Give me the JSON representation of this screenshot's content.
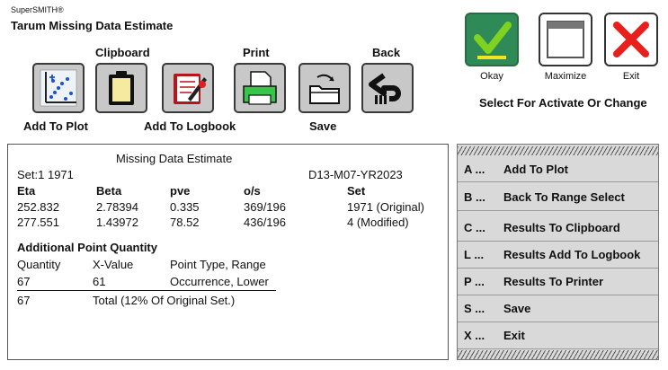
{
  "app": {
    "brand": "SuperSMITH®",
    "title": "Tarum Missing Data Estimate"
  },
  "toolbar": {
    "clipboard_label": "Clipboard",
    "print_label": "Print",
    "back_label": "Back",
    "add_to_plot_label": "Add To Plot",
    "add_to_logbook_label": "Add To Logbook",
    "save_label": "Save"
  },
  "window_buttons": {
    "okay_label": "Okay",
    "maximize_label": "Maximize",
    "exit_label": "Exit",
    "status": "Select For Activate Or Change"
  },
  "results": {
    "heading": "Missing Data Estimate",
    "set_label": "Set:1 1971",
    "id_code": "D13-M07-YR2023",
    "columns": [
      "Eta",
      "Beta",
      "pve",
      "o/s",
      "Set"
    ],
    "rows": [
      [
        "252.832",
        "2.78394",
        "0.335",
        "369/196",
        "1971 (Original)"
      ],
      [
        "277.551",
        "1.43972",
        "78.52",
        "436/196",
        "4 (Modified)"
      ]
    ],
    "additional_heading": "Additional Point Quantity",
    "add_columns": [
      "Quantity",
      "X-Value",
      "Point Type, Range"
    ],
    "add_row": [
      "67",
      "61",
      "Occurrence, Lower"
    ],
    "total_quantity": "67",
    "total_text": "Total (12% Of Original Set.)"
  },
  "menu": {
    "items": [
      {
        "key": "A ...",
        "label": "Add To Plot"
      },
      {
        "key": "B ...",
        "label": "Back To Range Select"
      },
      {
        "key": "C ...",
        "label": "Results To Clipboard"
      },
      {
        "key": "L ...",
        "label": "Results Add To Logbook"
      },
      {
        "key": "P ...",
        "label": "Results To Printer"
      },
      {
        "key": "S ...",
        "label": "Save"
      },
      {
        "key": "X ...",
        "label": "Exit"
      }
    ]
  },
  "icons": {
    "add_to_plot": "scatter-plot-icon",
    "clipboard": "clipboard-icon",
    "logbook": "logbook-icon",
    "print": "printer-icon",
    "save": "save-folder-icon",
    "back": "back-arrow-icon",
    "okay": "checkmark-icon",
    "maximize": "maximize-window-icon",
    "exit": "red-x-icon"
  },
  "colors": {
    "okay_bg": "#2e8b57",
    "check": "#7fd320",
    "okay_bar": "#f4e320",
    "exit_x": "#e8201d",
    "menu_bg": "#d9d9d9",
    "button_bg": "#c8c8c8"
  }
}
